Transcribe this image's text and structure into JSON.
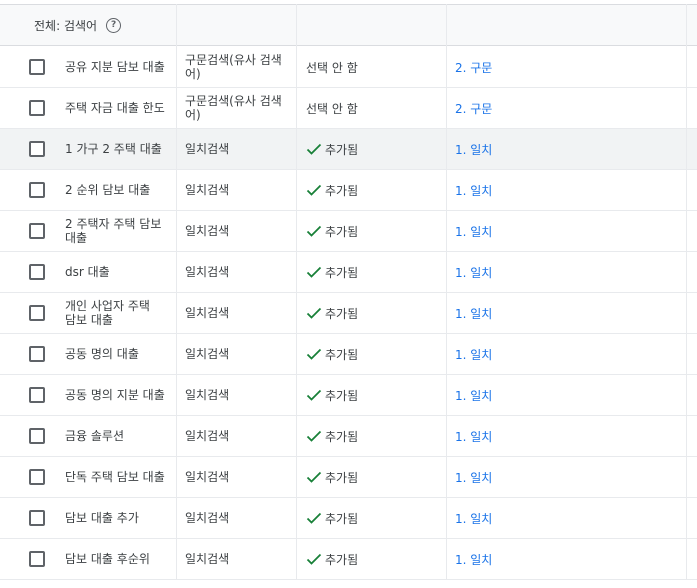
{
  "header": {
    "keyword_label": "전체: 검색어",
    "help_icon": "?"
  },
  "colors": {
    "link": "#1a73e8",
    "check": "#188038",
    "header_bg": "#f8f9fa"
  },
  "rows": [
    {
      "keyword": "공유 지분 담보 대출",
      "match_type": "구문검색(유사 검색어)",
      "status": "선택 안 함",
      "status_added": false,
      "group": "2. 구문"
    },
    {
      "keyword": "주택 자금 대출 한도",
      "match_type": "구문검색(유사 검색어)",
      "status": "선택 안 함",
      "status_added": false,
      "group": "2. 구문"
    },
    {
      "keyword": "1 가구 2 주택 대출",
      "match_type": "일치검색",
      "status": "추가됨",
      "status_added": true,
      "group": "1. 일치"
    },
    {
      "keyword": "2 순위 담보 대출",
      "match_type": "일치검색",
      "status": "추가됨",
      "status_added": true,
      "group": "1. 일치"
    },
    {
      "keyword": "2 주택자 주택 담보 대출",
      "match_type": "일치검색",
      "status": "추가됨",
      "status_added": true,
      "group": "1. 일치"
    },
    {
      "keyword": "dsr 대출",
      "match_type": "일치검색",
      "status": "추가됨",
      "status_added": true,
      "group": "1. 일치"
    },
    {
      "keyword": "개인 사업자 주택 담보 대출",
      "match_type": "일치검색",
      "status": "추가됨",
      "status_added": true,
      "group": "1. 일치"
    },
    {
      "keyword": "공동 명의 대출",
      "match_type": "일치검색",
      "status": "추가됨",
      "status_added": true,
      "group": "1. 일치"
    },
    {
      "keyword": "공동 명의 지분 대출",
      "match_type": "일치검색",
      "status": "추가됨",
      "status_added": true,
      "group": "1. 일치"
    },
    {
      "keyword": "금융 솔루션",
      "match_type": "일치검색",
      "status": "추가됨",
      "status_added": true,
      "group": "1. 일치"
    },
    {
      "keyword": "단독 주택 담보 대출",
      "match_type": "일치검색",
      "status": "추가됨",
      "status_added": true,
      "group": "1. 일치"
    },
    {
      "keyword": "담보 대출 추가",
      "match_type": "일치검색",
      "status": "추가됨",
      "status_added": true,
      "group": "1. 일치"
    },
    {
      "keyword": "담보 대출 후순위",
      "match_type": "일치검색",
      "status": "추가됨",
      "status_added": true,
      "group": "1. 일치"
    }
  ]
}
